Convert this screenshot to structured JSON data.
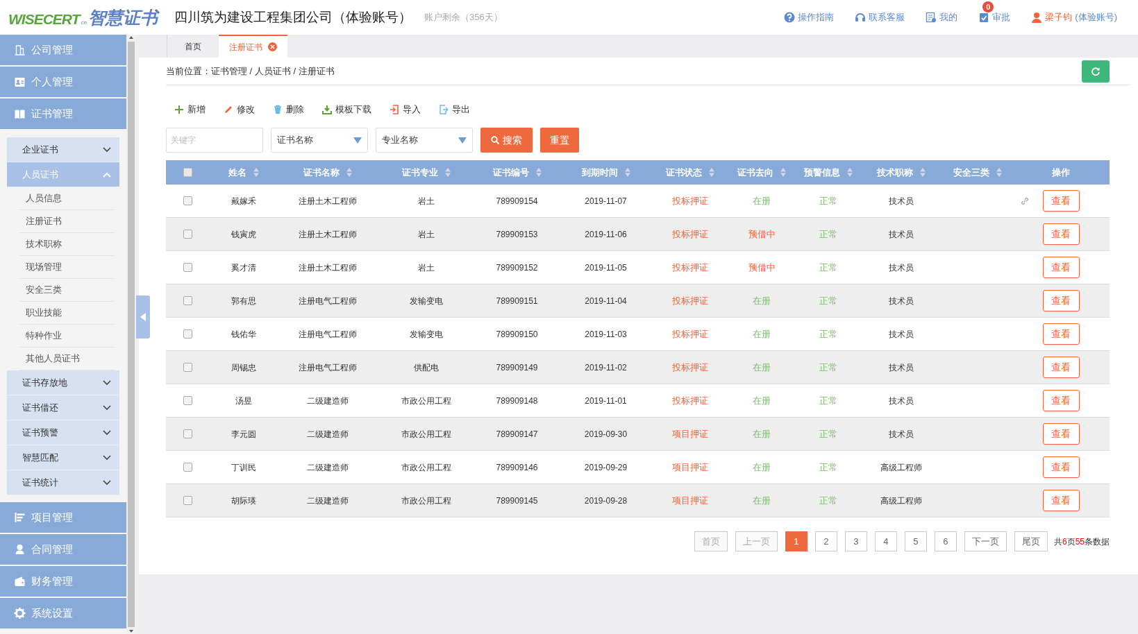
{
  "header": {
    "logo_latin": "WISECERT",
    "logo_suffix": "cn",
    "logo_cn": "智慧证书",
    "company": "四川筑为建设工程集团公司（体验账号）",
    "balance": "账户剩余（356天）",
    "links": [
      {
        "kind": "help",
        "label": "操作指南"
      },
      {
        "kind": "headset",
        "label": "联系客服"
      },
      {
        "kind": "doc",
        "label": "我的"
      },
      {
        "kind": "approve",
        "label": "审批",
        "badge": "0"
      }
    ],
    "user": {
      "name": "梁子钧",
      "account": "(体验账号)"
    }
  },
  "sidebar": {
    "items": [
      {
        "label": "公司管理"
      },
      {
        "label": "个人管理"
      },
      {
        "label": "证书管理",
        "children": [
          {
            "label": "企业证书",
            "expanded": false
          },
          {
            "label": "人员证书",
            "expanded": true,
            "children": [
              {
                "label": "人员信息"
              },
              {
                "label": "注册证书"
              },
              {
                "label": "技术职称"
              },
              {
                "label": "现场管理"
              },
              {
                "label": "安全三类"
              },
              {
                "label": "职业技能"
              },
              {
                "label": "特种作业"
              },
              {
                "label": "其他人员证书"
              }
            ]
          },
          {
            "label": "证书存放地",
            "expanded": false
          },
          {
            "label": "证书借还",
            "expanded": false
          },
          {
            "label": "证书预警",
            "expanded": false
          },
          {
            "label": "智慧匹配",
            "expanded": false
          },
          {
            "label": "证书统计",
            "expanded": false
          }
        ]
      },
      {
        "label": "项目管理"
      },
      {
        "label": "合同管理"
      },
      {
        "label": "财务管理"
      },
      {
        "label": "系统设置"
      }
    ]
  },
  "tabs": [
    {
      "label": "首页",
      "selected": false,
      "closable": false
    },
    {
      "label": "注册证书",
      "selected": true,
      "closable": true
    }
  ],
  "breadcrumb": "当前位置：证书管理 / 人员证书 / 注册证书",
  "toolbar": [
    {
      "label": "新增"
    },
    {
      "label": "修改"
    },
    {
      "label": "删除"
    },
    {
      "label": "模板下载"
    },
    {
      "label": "导入"
    },
    {
      "label": "导出"
    }
  ],
  "filters": {
    "keyword": {
      "placeholder": "关键字"
    },
    "selects": [
      {
        "value": "证书名称"
      },
      {
        "value": "专业名称"
      }
    ],
    "search_button": "搜索",
    "reset_button": "重置"
  },
  "table": {
    "select_all": {
      "checked": false
    },
    "columns": [
      {
        "label": "姓名",
        "sortable": true
      },
      {
        "label": "证书名称",
        "sortable": true
      },
      {
        "label": "证书专业",
        "sortable": true
      },
      {
        "label": "证书编号",
        "sortable": true
      },
      {
        "label": "到期时间",
        "sortable": true
      },
      {
        "label": "证书状态",
        "sortable": true
      },
      {
        "label": "证书去向",
        "sortable": true
      },
      {
        "label": "预警信息",
        "sortable": true
      },
      {
        "label": "技术职称",
        "sortable": true
      },
      {
        "label": "安全三类",
        "sortable": true
      },
      {
        "label": "操作",
        "sortable": false
      }
    ],
    "rows": [
      {
        "checked": false,
        "cells": [
          "戴嫁禾",
          "注册土木工程师",
          "岩土",
          "789909154",
          "2019-11-07"
        ],
        "status": {
          "text": "投标押证",
          "color": "#f0643c"
        },
        "direction": {
          "text": "在册",
          "color": "#7cc26a"
        },
        "warning": {
          "text": "正常",
          "color": "#7cc26a"
        },
        "title": "技术员",
        "linked": true,
        "action": "查看"
      },
      {
        "checked": false,
        "cells": [
          "钱寅虎",
          "注册土木工程师",
          "岩土",
          "789909153",
          "2019-11-06"
        ],
        "status": {
          "text": "投标押证",
          "color": "#f0643c"
        },
        "direction": {
          "text": "预借中",
          "color": "#f0643c"
        },
        "warning": {
          "text": "正常",
          "color": "#7cc26a"
        },
        "title": "技术员",
        "linked": false,
        "action": "查看"
      },
      {
        "checked": false,
        "cells": [
          "奚才清",
          "注册土木工程师",
          "岩土",
          "789909152",
          "2019-11-05"
        ],
        "status": {
          "text": "投标押证",
          "color": "#f0643c"
        },
        "direction": {
          "text": "预借中",
          "color": "#f0643c"
        },
        "warning": {
          "text": "正常",
          "color": "#7cc26a"
        },
        "title": "技术员",
        "linked": false,
        "action": "查看"
      },
      {
        "checked": false,
        "cells": [
          "郭有思",
          "注册电气工程师",
          "发输变电",
          "789909151",
          "2019-11-04"
        ],
        "status": {
          "text": "投标押证",
          "color": "#f0643c"
        },
        "direction": {
          "text": "在册",
          "color": "#7cc26a"
        },
        "warning": {
          "text": "正常",
          "color": "#7cc26a"
        },
        "title": "技术员",
        "linked": false,
        "action": "查看"
      },
      {
        "checked": false,
        "cells": [
          "钱佑华",
          "注册电气工程师",
          "发输变电",
          "789909150",
          "2019-11-03"
        ],
        "status": {
          "text": "投标押证",
          "color": "#f0643c"
        },
        "direction": {
          "text": "在册",
          "color": "#7cc26a"
        },
        "warning": {
          "text": "正常",
          "color": "#7cc26a"
        },
        "title": "技术员",
        "linked": false,
        "action": "查看"
      },
      {
        "checked": false,
        "cells": [
          "周锡忠",
          "注册电气工程师",
          "供配电",
          "789909149",
          "2019-11-02"
        ],
        "status": {
          "text": "投标押证",
          "color": "#f0643c"
        },
        "direction": {
          "text": "在册",
          "color": "#7cc26a"
        },
        "warning": {
          "text": "正常",
          "color": "#7cc26a"
        },
        "title": "技术员",
        "linked": false,
        "action": "查看"
      },
      {
        "checked": false,
        "cells": [
          "汤昱",
          "二级建造师",
          "市政公用工程",
          "789909148",
          "2019-11-01"
        ],
        "status": {
          "text": "投标押证",
          "color": "#f0643c"
        },
        "direction": {
          "text": "在册",
          "color": "#7cc26a"
        },
        "warning": {
          "text": "正常",
          "color": "#7cc26a"
        },
        "title": "技术员",
        "linked": false,
        "action": "查看"
      },
      {
        "checked": false,
        "cells": [
          "李元圆",
          "二级建造师",
          "市政公用工程",
          "789909147",
          "2019-09-30"
        ],
        "status": {
          "text": "项目押证",
          "color": "#f0643c"
        },
        "direction": {
          "text": "在册",
          "color": "#7cc26a"
        },
        "warning": {
          "text": "正常",
          "color": "#7cc26a"
        },
        "title": "技术员",
        "linked": false,
        "action": "查看"
      },
      {
        "checked": false,
        "cells": [
          "丁训民",
          "二级建造师",
          "市政公用工程",
          "789909146",
          "2019-09-29"
        ],
        "status": {
          "text": "项目押证",
          "color": "#f0643c"
        },
        "direction": {
          "text": "在册",
          "color": "#7cc26a"
        },
        "warning": {
          "text": "正常",
          "color": "#7cc26a"
        },
        "title": "高级工程师",
        "linked": false,
        "action": "查看"
      },
      {
        "checked": false,
        "cells": [
          "胡际瑛",
          "二级建造师",
          "市政公用工程",
          "789909145",
          "2019-09-28"
        ],
        "status": {
          "text": "项目押证",
          "color": "#f0643c"
        },
        "direction": {
          "text": "在册",
          "color": "#7cc26a"
        },
        "warning": {
          "text": "正常",
          "color": "#7cc26a"
        },
        "title": "高级工程师",
        "linked": false,
        "action": "查看"
      }
    ]
  },
  "pagination": {
    "items": [
      {
        "label": "首页",
        "disabled": true,
        "selected": false
      },
      {
        "label": "上一页",
        "disabled": true,
        "selected": false
      },
      {
        "label": "1",
        "disabled": false,
        "selected": true
      },
      {
        "label": "2",
        "disabled": false,
        "selected": false
      },
      {
        "label": "3",
        "disabled": false,
        "selected": false
      },
      {
        "label": "4",
        "disabled": false,
        "selected": false
      },
      {
        "label": "5",
        "disabled": false,
        "selected": false
      },
      {
        "label": "6",
        "disabled": false,
        "selected": false
      },
      {
        "label": "下一页",
        "disabled": false,
        "selected": false
      },
      {
        "label": "尾页",
        "disabled": false,
        "selected": false
      }
    ],
    "summary": {
      "prefix": "共",
      "pages": "6",
      "middle": "页",
      "total": "55",
      "suffix": "条数据"
    }
  }
}
